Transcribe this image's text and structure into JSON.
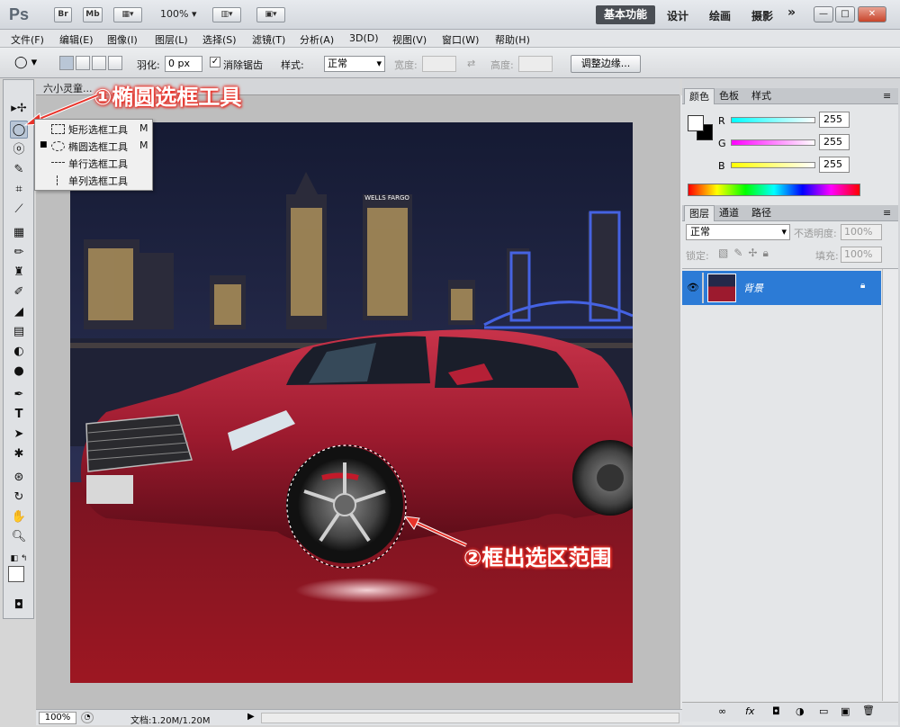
{
  "app": {
    "logo": "Ps",
    "bridge_button": "Br",
    "minibridge_button": "Mb",
    "zoom": "100%",
    "workspaces": [
      "基本功能",
      "设计",
      "绘画",
      "摄影"
    ],
    "more": "»"
  },
  "window_controls": {
    "minimize": "—",
    "maximize": "□",
    "close": "✕"
  },
  "menu": [
    "文件(F)",
    "编辑(E)",
    "图像(I)",
    "图层(L)",
    "选择(S)",
    "滤镜(T)",
    "分析(A)",
    "3D(D)",
    "视图(V)",
    "窗口(W)",
    "帮助(H)"
  ],
  "options": {
    "feather_label": "羽化:",
    "feather_value": "0 px",
    "antialias_label": "消除锯齿",
    "antialias_checked": "✓",
    "style_label": "样式:",
    "style_value": "正常",
    "width_label": "宽度:",
    "height_label": "高度:",
    "refine_button": "调整边缘..."
  },
  "document": {
    "tab_label": "六小灵童...",
    "zoom": "100%",
    "info": "文档:1.20M/1.20M"
  },
  "flyout": {
    "items": [
      {
        "label": "矩形选框工具",
        "key": "M",
        "selected": false
      },
      {
        "label": "椭圆选框工具",
        "key": "M",
        "selected": true
      },
      {
        "label": "单行选框工具",
        "key": "",
        "selected": false
      },
      {
        "label": "单列选框工具",
        "key": "",
        "selected": false
      }
    ],
    "bullet": "■"
  },
  "color_panel": {
    "tabs": [
      "颜色",
      "色板",
      "样式"
    ],
    "channels": [
      {
        "label": "R",
        "value": "255",
        "color": "#00e5e5"
      },
      {
        "label": "G",
        "value": "255",
        "color": "#e534e5"
      },
      {
        "label": "B",
        "value": "255",
        "color": "#e5e534"
      }
    ]
  },
  "layers_panel": {
    "tabs": [
      "图层",
      "通道",
      "路径"
    ],
    "blend_mode": "正常",
    "opacity_label": "不透明度:",
    "opacity_value": "100%",
    "lock_label": "锁定:",
    "fill_label": "填充:",
    "fill_value": "100%",
    "layer_name": "背景",
    "footer_icons": [
      "link-icon",
      "fx-icon",
      "mask-icon",
      "adjustment-icon",
      "group-icon",
      "new-layer-icon",
      "trash-icon"
    ],
    "footer_labels": [
      "∞",
      "fx",
      "◘",
      "◑",
      "▭",
      "▣",
      "🗑"
    ]
  },
  "annotations": {
    "step1": "①椭圆选框工具",
    "step2": "②框出选区范围"
  },
  "colors": {
    "accent_selected_layer": "#2c7bd6",
    "annotation_red": "#e8332a",
    "car_red": "#a31a2a"
  }
}
